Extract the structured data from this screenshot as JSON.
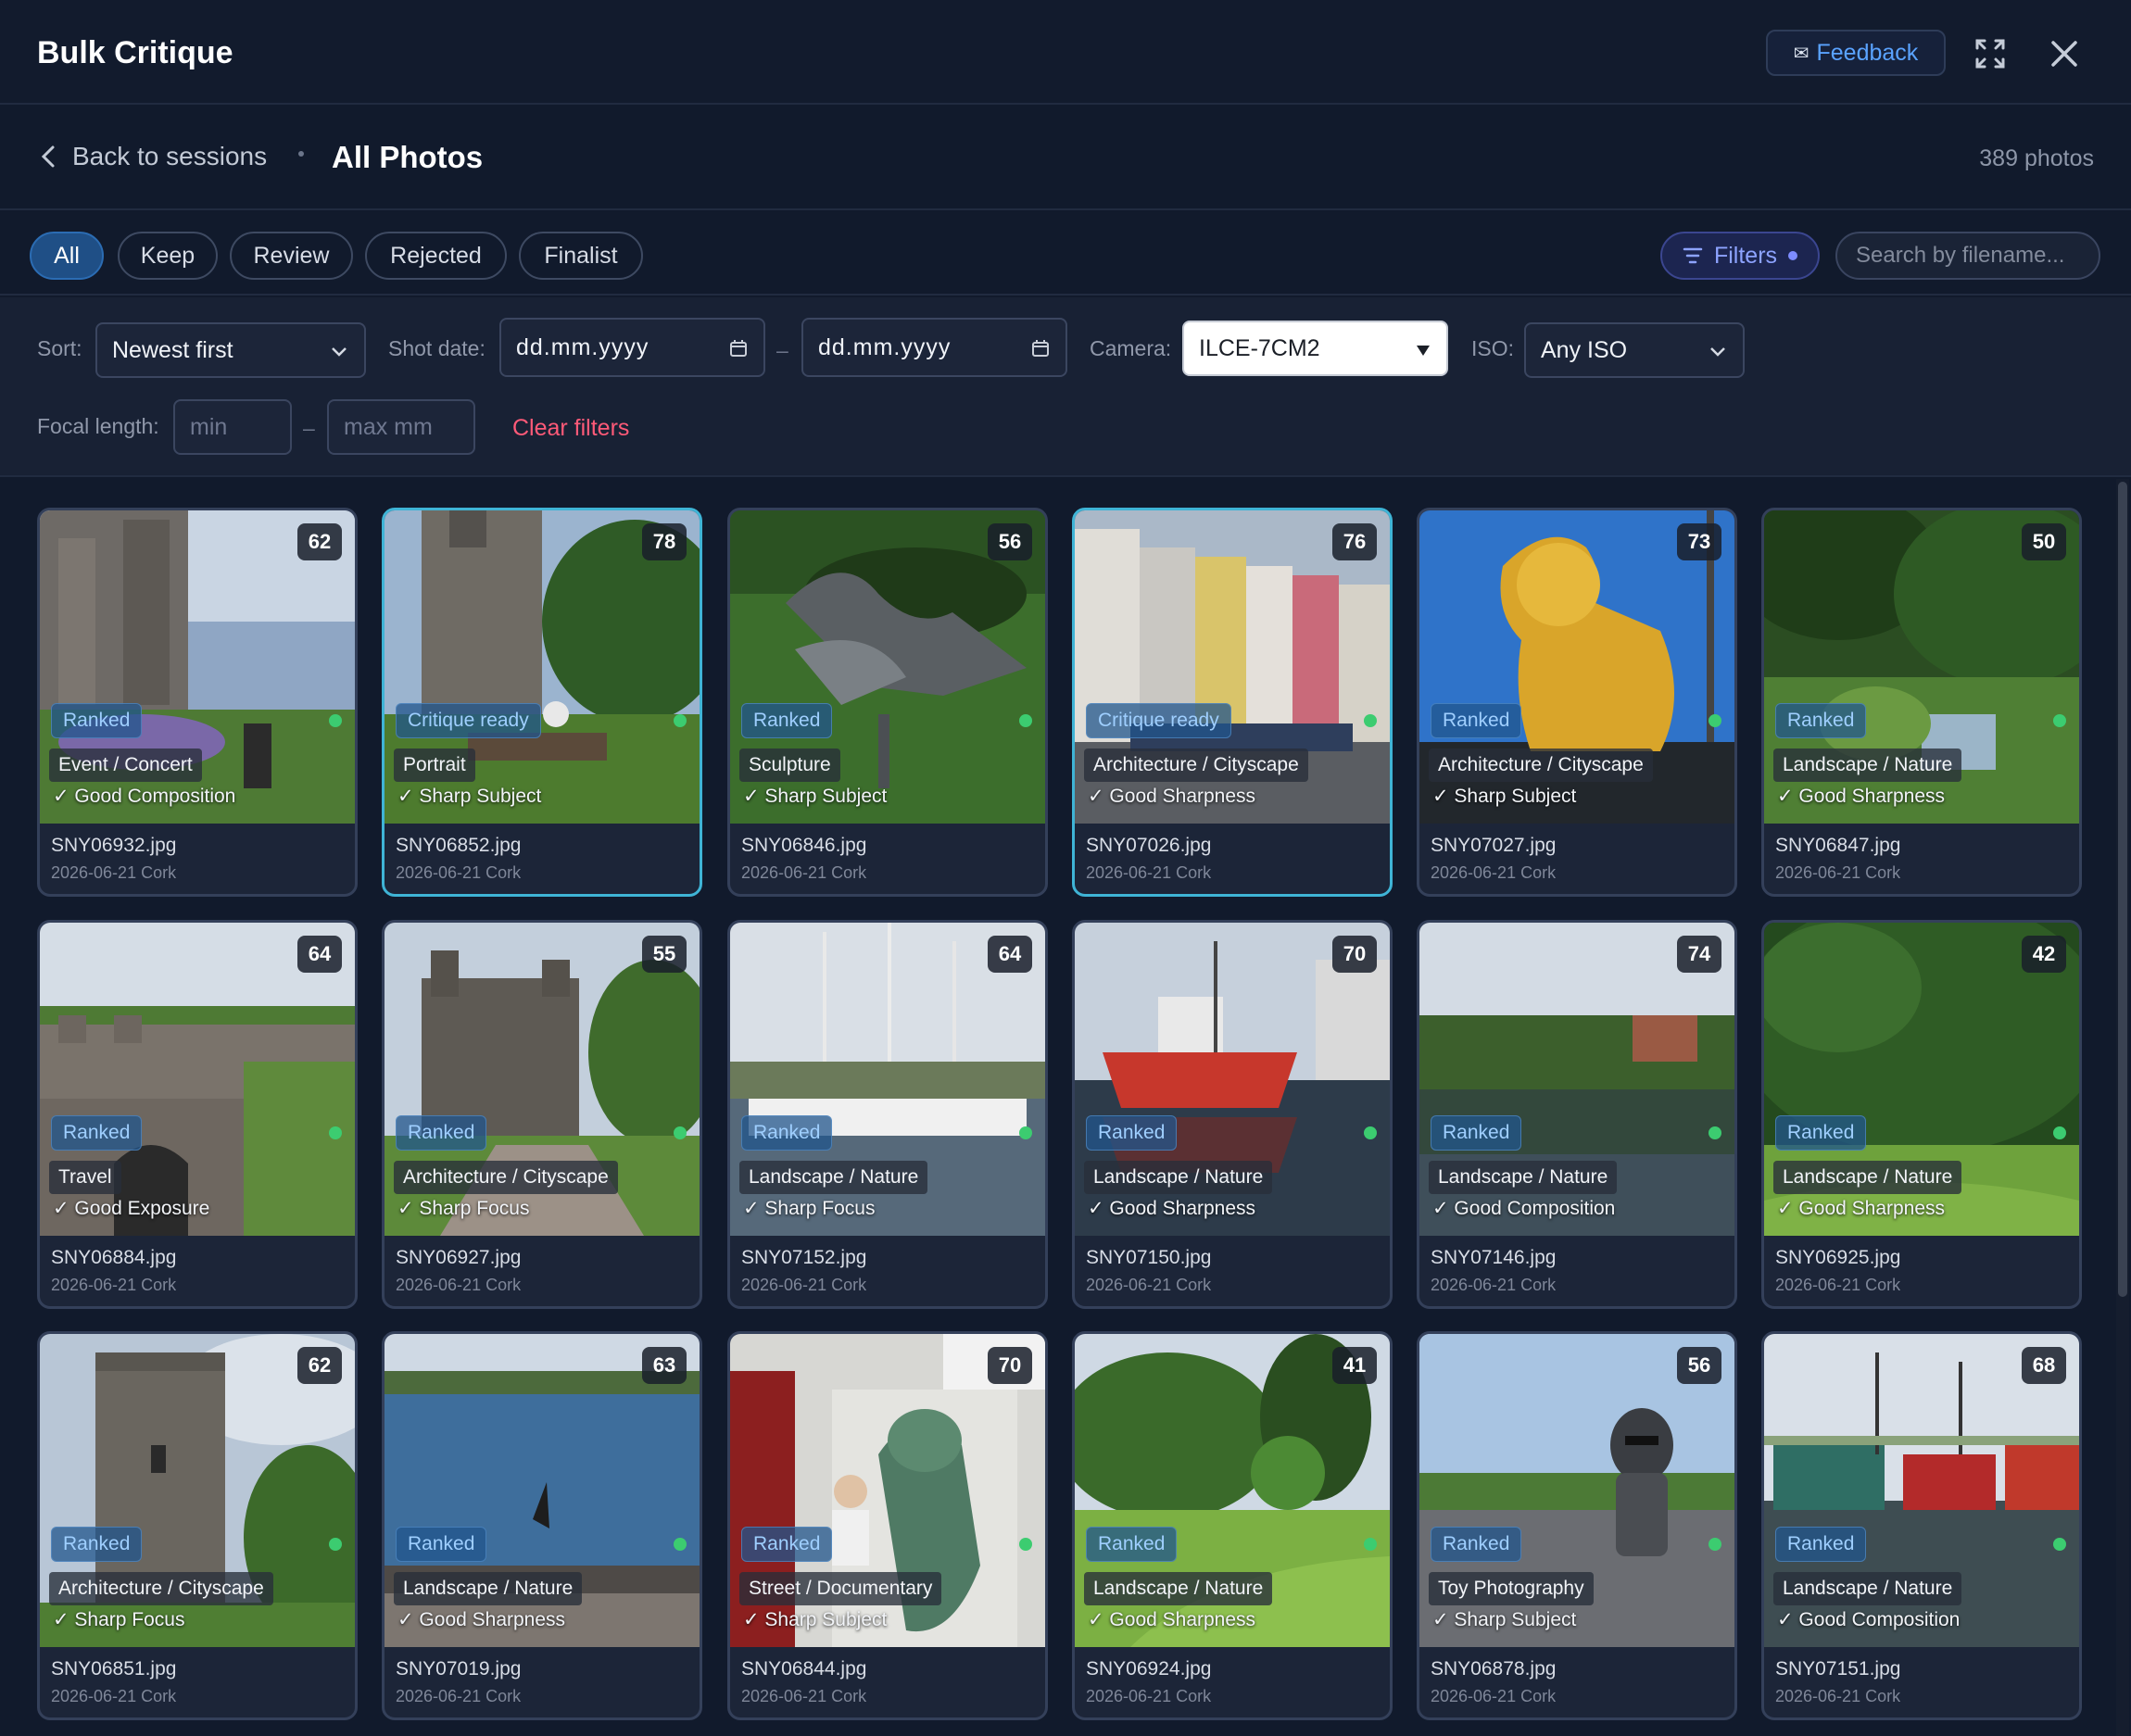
{
  "app": {
    "title": "Bulk Critique",
    "feedback_label": "Feedback"
  },
  "breadcrumb": {
    "back_label": "Back to sessions",
    "current": "All Photos",
    "count": "389 photos"
  },
  "tabs": [
    {
      "label": "All",
      "active": true
    },
    {
      "label": "Keep",
      "active": false
    },
    {
      "label": "Review",
      "active": false
    },
    {
      "label": "Rejected",
      "active": false
    },
    {
      "label": "Finalist",
      "active": false
    }
  ],
  "filters_button": {
    "label": "Filters"
  },
  "search": {
    "placeholder": "Search by filename..."
  },
  "filter_panel": {
    "sort_label": "Sort:",
    "sort_value": "Newest first",
    "date_label": "Shot date:",
    "date_from": "dd.mm.yyyy",
    "date_to": "dd.mm.yyyy",
    "date_sep": "–",
    "camera_label": "Camera:",
    "camera_value": "ILCE-7CM2",
    "iso_label": "ISO:",
    "iso_value": "Any ISO",
    "focal_label": "Focal length:",
    "focal_min_placeholder": "min",
    "focal_max_placeholder": "max mm",
    "focal_sep": "–",
    "clear_label": "Clear filters"
  },
  "photos": [
    {
      "score": "62",
      "status": "Ranked",
      "category": "Event / Concert",
      "quality": "✓ Good Composition",
      "filename": "SNY06932.jpg",
      "meta": "2026-06-21 Cork",
      "selected": false,
      "scene": "castle-garden"
    },
    {
      "score": "78",
      "status": "Critique ready",
      "category": "Portrait",
      "quality": "✓ Sharp Subject",
      "filename": "SNY06852.jpg",
      "meta": "2026-06-21 Cork",
      "selected": true,
      "scene": "castle-trees"
    },
    {
      "score": "56",
      "status": "Ranked",
      "category": "Sculpture",
      "quality": "✓ Sharp Subject",
      "filename": "SNY06846.jpg",
      "meta": "2026-06-21 Cork",
      "selected": false,
      "scene": "bird-sculpture"
    },
    {
      "score": "76",
      "status": "Critique ready",
      "category": "Architecture / Cityscape",
      "quality": "✓ Good Sharpness",
      "filename": "SNY07026.jpg",
      "meta": "2026-06-21 Cork",
      "selected": true,
      "scene": "street"
    },
    {
      "score": "73",
      "status": "Ranked",
      "category": "Architecture / Cityscape",
      "quality": "✓ Sharp Subject",
      "filename": "SNY07027.jpg",
      "meta": "2026-06-21 Cork",
      "selected": false,
      "scene": "golden-lion"
    },
    {
      "score": "50",
      "status": "Ranked",
      "category": "Landscape / Nature",
      "quality": "✓ Good Sharpness",
      "filename": "SNY06847.jpg",
      "meta": "2026-06-21 Cork",
      "selected": false,
      "scene": "forest"
    },
    {
      "score": "64",
      "status": "Ranked",
      "category": "Travel",
      "quality": "✓ Good Exposure",
      "filename": "SNY06884.jpg",
      "meta": "2026-06-21 Cork",
      "selected": false,
      "scene": "ruins"
    },
    {
      "score": "55",
      "status": "Ranked",
      "category": "Architecture / Cityscape",
      "quality": "✓ Sharp Focus",
      "filename": "SNY06927.jpg",
      "meta": "2026-06-21 Cork",
      "selected": false,
      "scene": "castle-house"
    },
    {
      "score": "64",
      "status": "Ranked",
      "category": "Landscape / Nature",
      "quality": "✓ Sharp Focus",
      "filename": "SNY07152.jpg",
      "meta": "2026-06-21 Cork",
      "selected": false,
      "scene": "harbor-masts"
    },
    {
      "score": "70",
      "status": "Ranked",
      "category": "Landscape / Nature",
      "quality": "✓ Good Sharpness",
      "filename": "SNY07150.jpg",
      "meta": "2026-06-21 Cork",
      "selected": false,
      "scene": "red-boat"
    },
    {
      "score": "74",
      "status": "Ranked",
      "category": "Landscape / Nature",
      "quality": "✓ Good Composition",
      "filename": "SNY07146.jpg",
      "meta": "2026-06-21 Cork",
      "selected": false,
      "scene": "reflection"
    },
    {
      "score": "42",
      "status": "Ranked",
      "category": "Landscape / Nature",
      "quality": "✓ Good Sharpness",
      "filename": "SNY06925.jpg",
      "meta": "2026-06-21 Cork",
      "selected": false,
      "scene": "park-tree"
    },
    {
      "score": "62",
      "status": "Ranked",
      "category": "Architecture / Cityscape",
      "quality": "✓ Sharp Focus",
      "filename": "SNY06851.jpg",
      "meta": "2026-06-21 Cork",
      "selected": false,
      "scene": "tower"
    },
    {
      "score": "63",
      "status": "Ranked",
      "category": "Landscape / Nature",
      "quality": "✓ Good Sharpness",
      "filename": "SNY07019.jpg",
      "meta": "2026-06-21 Cork",
      "selected": false,
      "scene": "sea"
    },
    {
      "score": "70",
      "status": "Ranked",
      "category": "Street / Documentary",
      "quality": "✓ Sharp Subject",
      "filename": "SNY06844.jpg",
      "meta": "2026-06-21 Cork",
      "selected": false,
      "scene": "mural"
    },
    {
      "score": "41",
      "status": "Ranked",
      "category": "Landscape / Nature",
      "quality": "✓ Good Sharpness",
      "filename": "SNY06924.jpg",
      "meta": "2026-06-21 Cork",
      "selected": false,
      "scene": "park-lawn"
    },
    {
      "score": "56",
      "status": "Ranked",
      "category": "Toy Photography",
      "quality": "✓ Sharp Subject",
      "filename": "SNY06878.jpg",
      "meta": "2026-06-21 Cork",
      "selected": false,
      "scene": "toy"
    },
    {
      "score": "68",
      "status": "Ranked",
      "category": "Landscape / Nature",
      "quality": "✓ Good Composition",
      "filename": "SNY07151.jpg",
      "meta": "2026-06-21 Cork",
      "selected": false,
      "scene": "trawlers"
    }
  ]
}
